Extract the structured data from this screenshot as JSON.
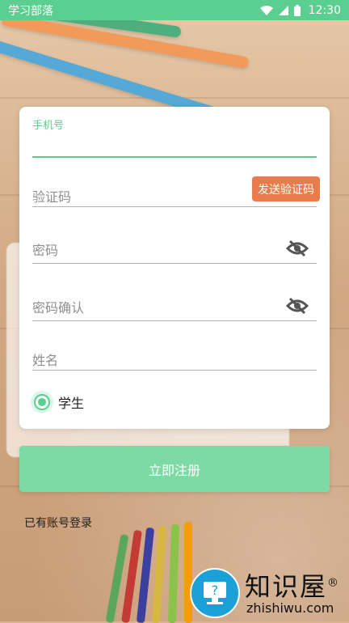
{
  "status_bar": {
    "app_name": "学习部落",
    "time": "12:30"
  },
  "form": {
    "phone": {
      "label": "手机号",
      "value": ""
    },
    "code": {
      "placeholder": "验证码",
      "send_button": "发送验证码"
    },
    "password": {
      "placeholder": "密码",
      "icon": "eye-off-icon"
    },
    "confirm_password": {
      "placeholder": "密码确认",
      "icon": "eye-off-icon"
    },
    "name": {
      "placeholder": "姓名"
    },
    "role": {
      "label": "学生",
      "selected": true
    }
  },
  "register_button": "立即注册",
  "login_link": "已有账号登录",
  "watermark": {
    "title": "知识屋",
    "registered_mark": "®",
    "url": "zhishiwu.com"
  },
  "colors": {
    "accent_green": "#5bcf8f",
    "button_green": "#7ddaa4",
    "orange": "#ea7b4d",
    "watermark_blue": "#1aa2d8"
  }
}
